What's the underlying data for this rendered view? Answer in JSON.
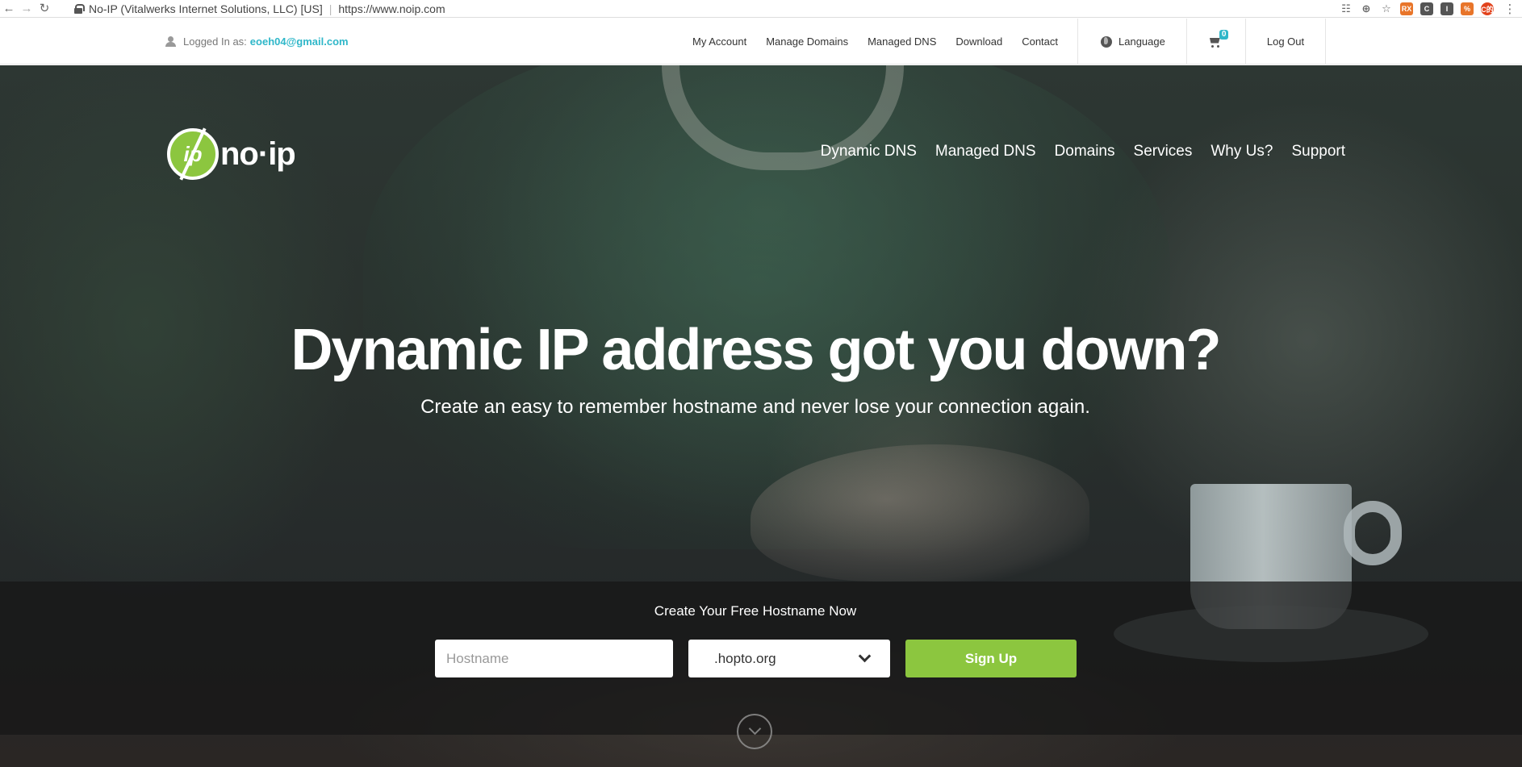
{
  "browser": {
    "page_title": "No-IP (Vitalwerks Internet Solutions, LLC) [US]",
    "url": "https://www.noip.com",
    "nav_icons": [
      "back-icon",
      "forward-icon",
      "reload-icon"
    ],
    "extensions": [
      {
        "label": "RX",
        "icon": "rx-extension-icon"
      },
      {
        "label": "C",
        "icon": "c-extension-icon"
      },
      {
        "label": "I",
        "icon": "i-extension-icon"
      },
      {
        "label": "%",
        "icon": "percent-extension-icon"
      },
      {
        "label": "C的",
        "icon": "profile-extension-icon"
      }
    ]
  },
  "topbar": {
    "logged_label": "Logged In as:",
    "email": "eoeh04@gmail.com",
    "links": [
      "My Account",
      "Manage Domains",
      "Managed DNS",
      "Download",
      "Contact"
    ],
    "language": "Language",
    "cart_count": "0",
    "logout": "Log Out"
  },
  "brand": {
    "logo_mark": "ip",
    "logo_text": "no·ip",
    "colors": {
      "green": "#8cc63f",
      "teal": "#2fb7c9"
    }
  },
  "mainnav": [
    "Dynamic DNS",
    "Managed DNS",
    "Domains",
    "Services",
    "Why Us?",
    "Support"
  ],
  "hero": {
    "headline": "Dynamic IP address got you down?",
    "subline": "Create an easy to remember hostname and never lose your connection again."
  },
  "signup": {
    "title": "Create Your Free Hostname Now",
    "hostname_placeholder": "Hostname",
    "hostname_value": "",
    "domain_selected": ".hopto.org",
    "button": "Sign Up"
  }
}
